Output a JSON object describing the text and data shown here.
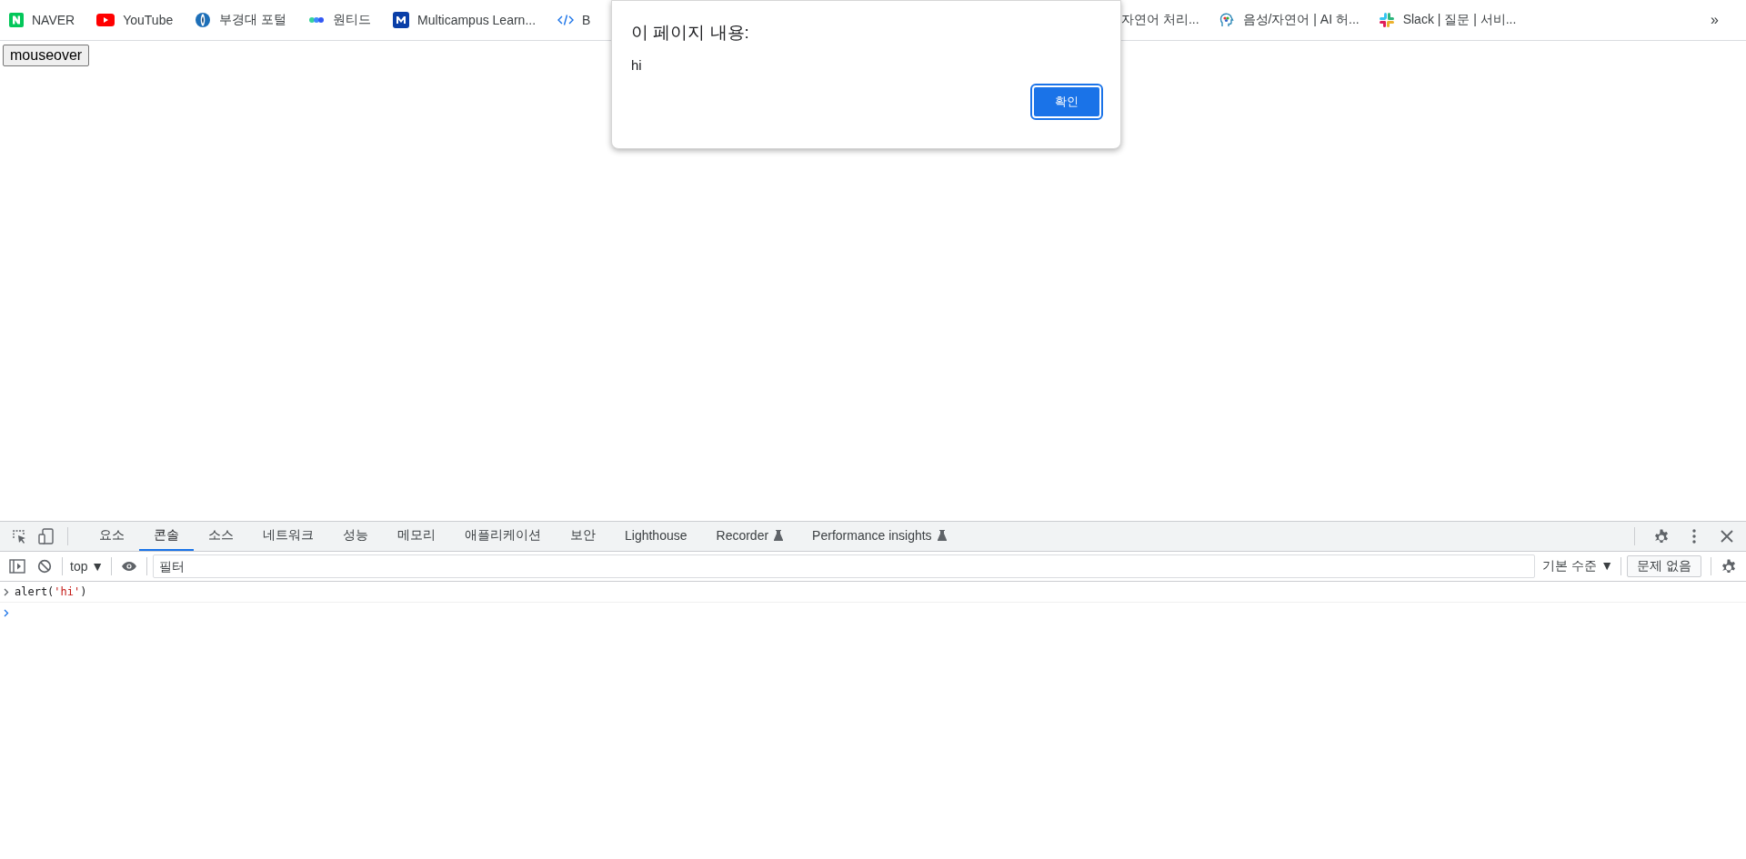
{
  "bookmarks": [
    {
      "label": "NAVER"
    },
    {
      "label": "YouTube"
    },
    {
      "label": "부경대 포털"
    },
    {
      "label": "원티드"
    },
    {
      "label": "Multicampus Learn..."
    },
    {
      "label": "B"
    },
    {
      "label": "자연어 처리..."
    },
    {
      "label": "음성/자연어 | AI 허..."
    },
    {
      "label": "Slack | 질문 | 서비..."
    }
  ],
  "bookmarks_more": "»",
  "page": {
    "button": "mouseover"
  },
  "dialog": {
    "title": "이 페이지 내용:",
    "message": "hi",
    "ok_button": "확인"
  },
  "devtools": {
    "tabs": [
      {
        "label": "요소",
        "selected": false,
        "experimental": false
      },
      {
        "label": "콘솔",
        "selected": true,
        "experimental": false
      },
      {
        "label": "소스",
        "selected": false,
        "experimental": false
      },
      {
        "label": "네트워크",
        "selected": false,
        "experimental": false
      },
      {
        "label": "성능",
        "selected": false,
        "experimental": false
      },
      {
        "label": "메모리",
        "selected": false,
        "experimental": false
      },
      {
        "label": "애플리케이션",
        "selected": false,
        "experimental": false
      },
      {
        "label": "보안",
        "selected": false,
        "experimental": false
      },
      {
        "label": "Lighthouse",
        "selected": false,
        "experimental": false
      },
      {
        "label": "Recorder",
        "selected": false,
        "experimental": true
      },
      {
        "label": "Performance insights",
        "selected": false,
        "experimental": true
      }
    ],
    "context": "top",
    "context_caret": "▼",
    "level_caret": "▼",
    "filter": {
      "placeholder": "필터"
    },
    "level": "기본 수준",
    "issues": "문제 없음",
    "console": [
      {
        "kind": "input",
        "tokens": [
          {
            "kind": "plain",
            "text": "alert("
          },
          {
            "kind": "string",
            "text": "'hi'"
          },
          {
            "kind": "plain",
            "text": ")"
          }
        ]
      },
      {
        "kind": "prompt"
      }
    ]
  }
}
